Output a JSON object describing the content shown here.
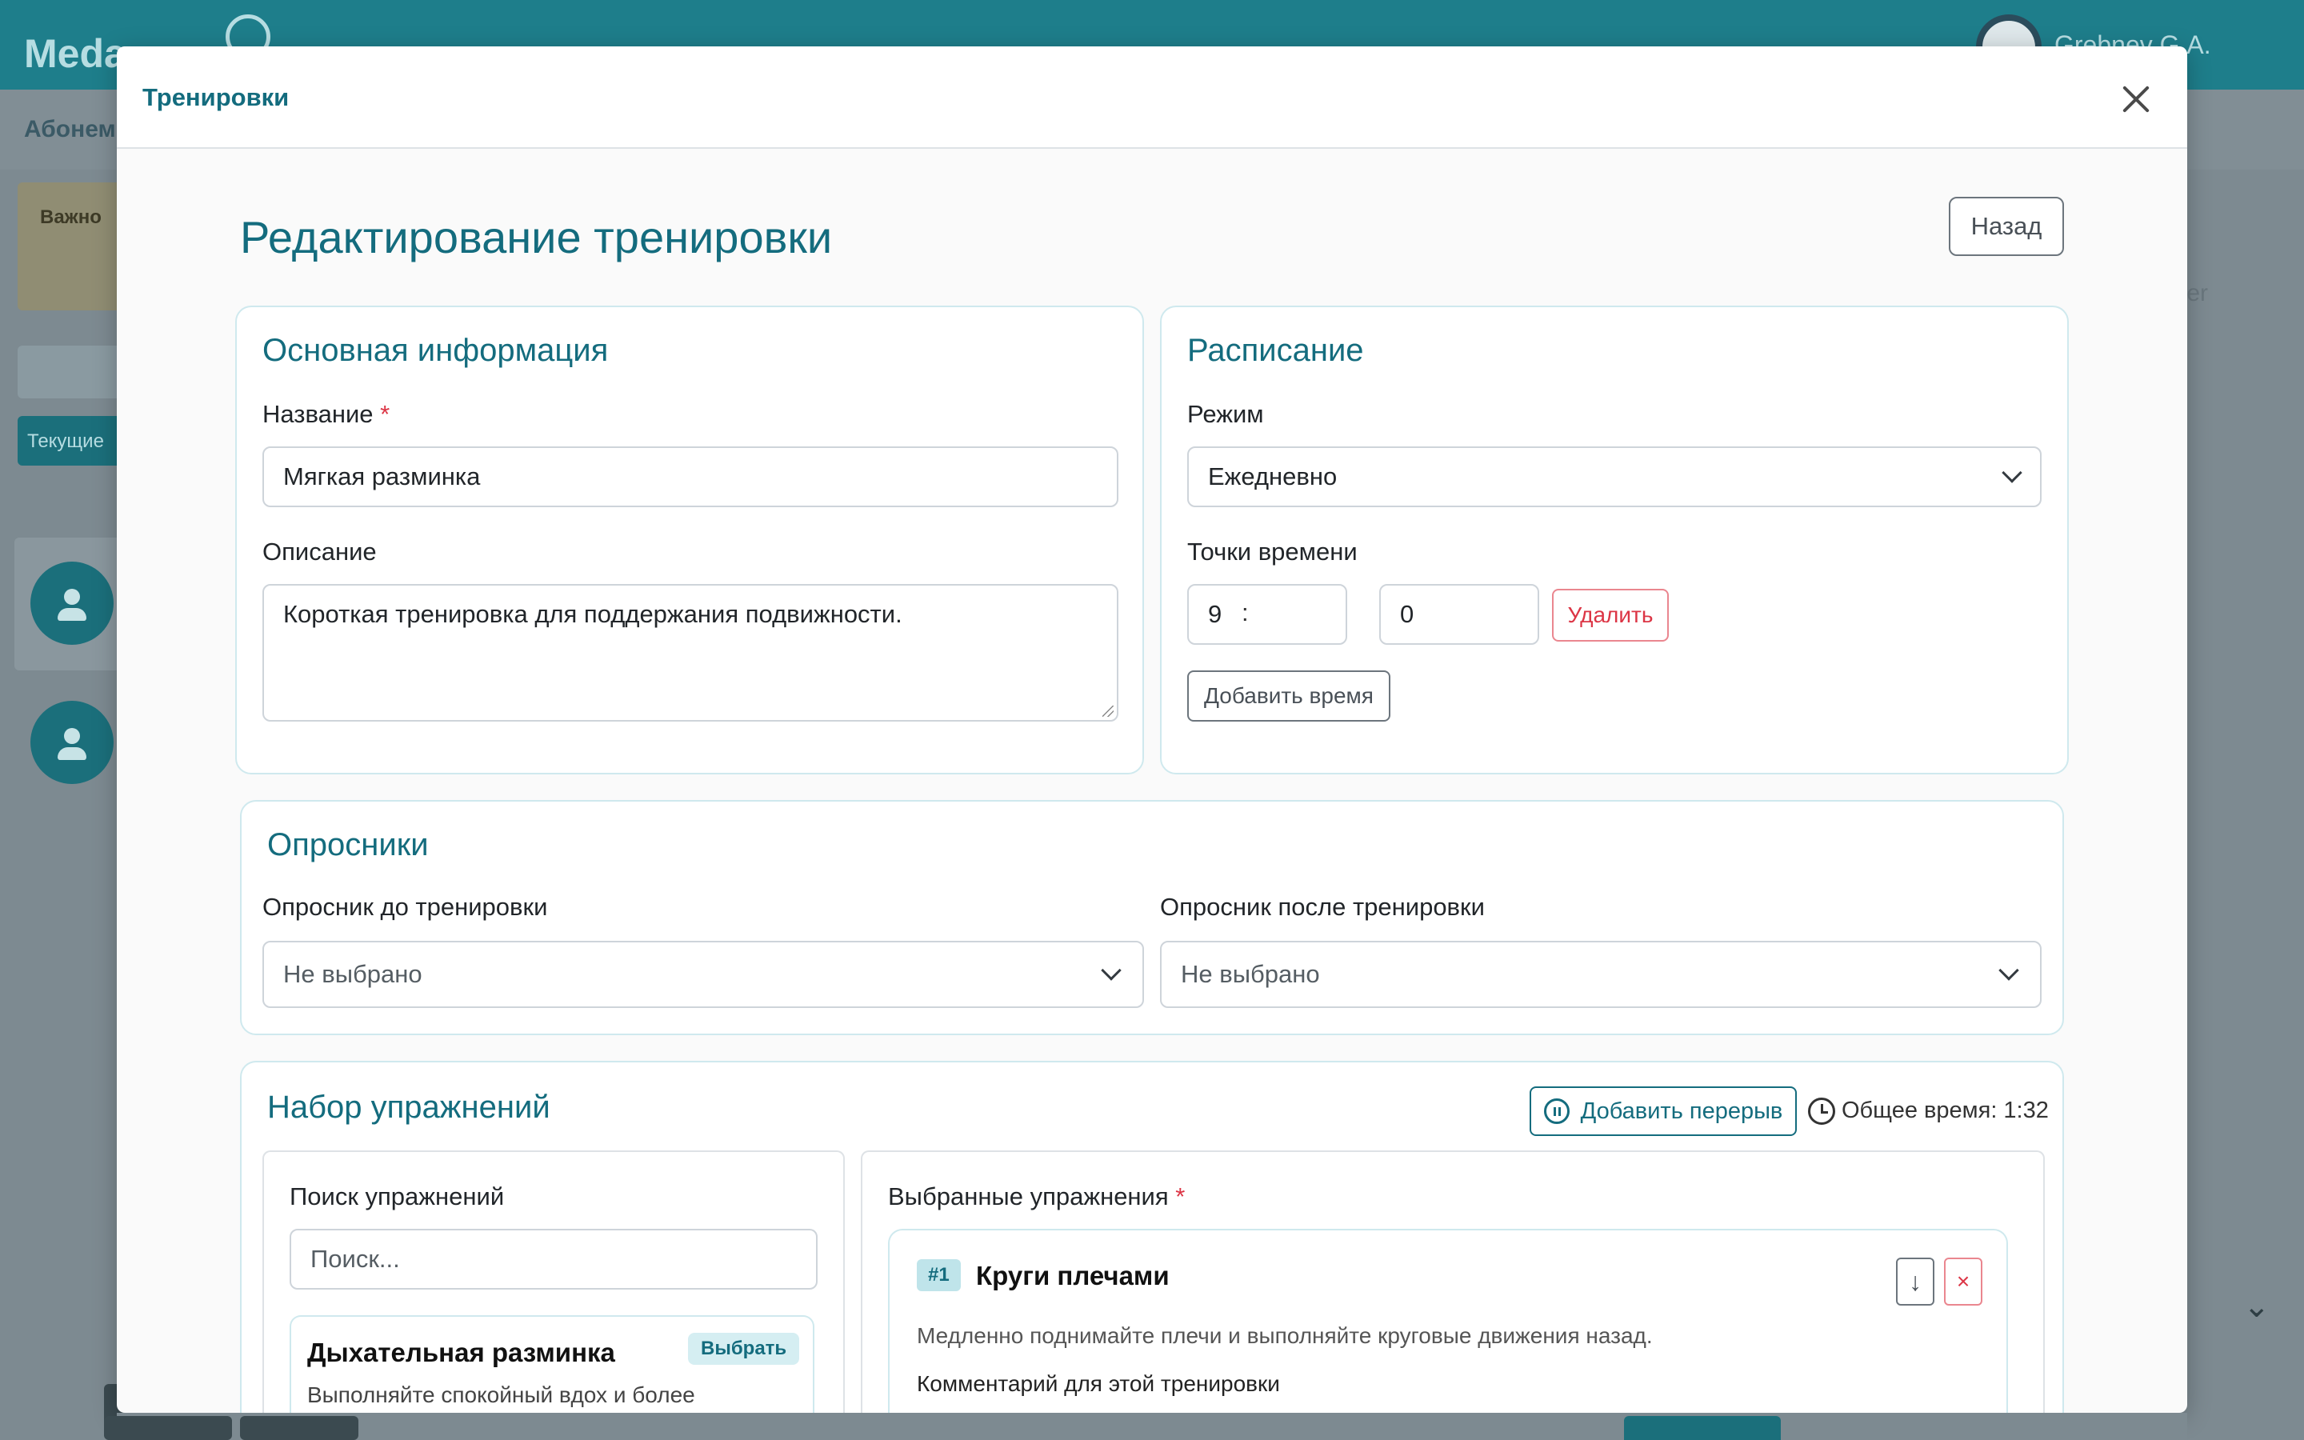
{
  "background": {
    "logo_text": "Meda",
    "user_name": "Grebnev G.A.",
    "subnav_text": "Абонем",
    "warning_text": "Важно",
    "tab_text": "Текущие",
    "right_text": "nger"
  },
  "modal": {
    "title": "Тренировки",
    "close_label": "Закрыть"
  },
  "page": {
    "title": "Редактирование тренировки",
    "back_label": "Назад"
  },
  "basic_info": {
    "title": "Основная информация",
    "name_label": "Название",
    "required_mark": "*",
    "name_value": "Мягкая разминка",
    "description_label": "Описание",
    "description_value": "Короткая тренировка для поддержания подвижности."
  },
  "schedule": {
    "title": "Расписание",
    "mode_label": "Режим",
    "mode_value": "Ежедневно",
    "time_points_label": "Точки времени",
    "hour_value": "9",
    "separator": ":",
    "minute_value": "0",
    "delete_label": "Удалить",
    "add_time_label": "Добавить время"
  },
  "questionnaires": {
    "title": "Опросники",
    "before_label": "Опросник до тренировки",
    "before_value": "Не выбрано",
    "after_label": "Опросник после тренировки",
    "after_value": "Не выбрано"
  },
  "exercises": {
    "title": "Набор упражнений",
    "add_break_label": "Добавить перерыв",
    "total_time": "Общее время: 1:32",
    "search_label": "Поиск упражнений",
    "search_placeholder": "Поиск...",
    "library": [
      {
        "name": "Дыхательная разминка",
        "pick_label": "Выбрать",
        "description": "Выполняйте спокойный вдох и более"
      }
    ],
    "selected_label": "Выбранные упражнения",
    "required_mark": "*",
    "selected": [
      {
        "number": "#1",
        "name": "Круги плечами",
        "description": "Медленно поднимайте плечи и выполняйте круговые движения назад.",
        "comment_label": "Комментарий для этой тренировки",
        "move_down_symbol": "↓",
        "remove_symbol": "×"
      }
    ]
  },
  "colors": {
    "primary": "#146c7e",
    "danger": "#dc3545",
    "topbar": "#1e7e8b",
    "card_border": "#cfe9ee"
  }
}
